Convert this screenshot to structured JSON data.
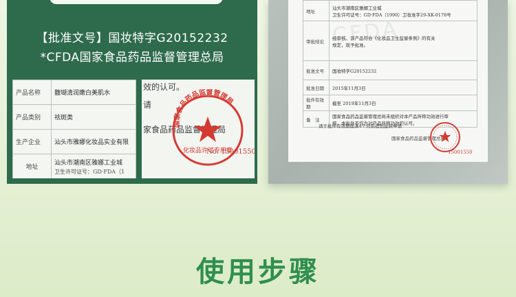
{
  "colors": {
    "panel_green": "#2e6b4c",
    "title_green": "#2f8f4e",
    "stamp_red": "#d43a32"
  },
  "approval": {
    "line1": "【批准文号】国妆特字G20152232",
    "line2": "*CFDA国家食品药品监督管理总局"
  },
  "product_table": [
    {
      "label": "产品名称",
      "value": "馥瑚清润嫩白美肌水",
      "sub": ""
    },
    {
      "label": "产品类别",
      "value": "祛斑类",
      "sub": ""
    },
    {
      "label": "生产企业",
      "value": "汕头市雅娜化妆品实业有限",
      "sub": ""
    },
    {
      "label": "地址",
      "value": "汕头市潮南区雅娜工业城",
      "sub": "卫生许可证号：GD·FDA（1"
    }
  ],
  "stamp_photo": {
    "text_top": "效的认可。",
    "text_mid": "请",
    "text_main": "家食品药品监督管理局",
    "stamp_arc": "国家食品药品监督管理局",
    "stamp_bottom": "化妆品许可专用章",
    "stamp_no": "No. 15001550"
  },
  "certificate": {
    "watermark": "CFDA",
    "rows": [
      {
        "k": "地址",
        "v": "汕头市潮南区雅娜工业城",
        "v2": "卫生许可证号：GD·FDA（1990）卫妆准字29-XK-0178号"
      },
      {
        "k": "审批结论",
        "v": "经审核，该产品符合《化妆品卫生监督条例》的有关",
        "v2": "规定，现予批准。"
      },
      {
        "k": "批准文号",
        "v": "国妆特字G20152232",
        "v2": ""
      },
      {
        "k": "批准日期",
        "v": "2015年11月3日",
        "v2": ""
      },
      {
        "k": "批件有效期",
        "v": "截至 2019年11月3日",
        "v2": ""
      },
      {
        "k": "备　注",
        "v": "国家食品药品监督管理总局未组织对本产品所称功效进行审",
        "v2": "核，本批件不作为对产品所称功效的认可。"
      }
    ],
    "renewal_note": "请于批件有效期届满4个月前提出延续申请",
    "issuer": "国家食品药品监督管理总局",
    "stamp_no": "15001550"
  },
  "section_title": "使用步骤"
}
